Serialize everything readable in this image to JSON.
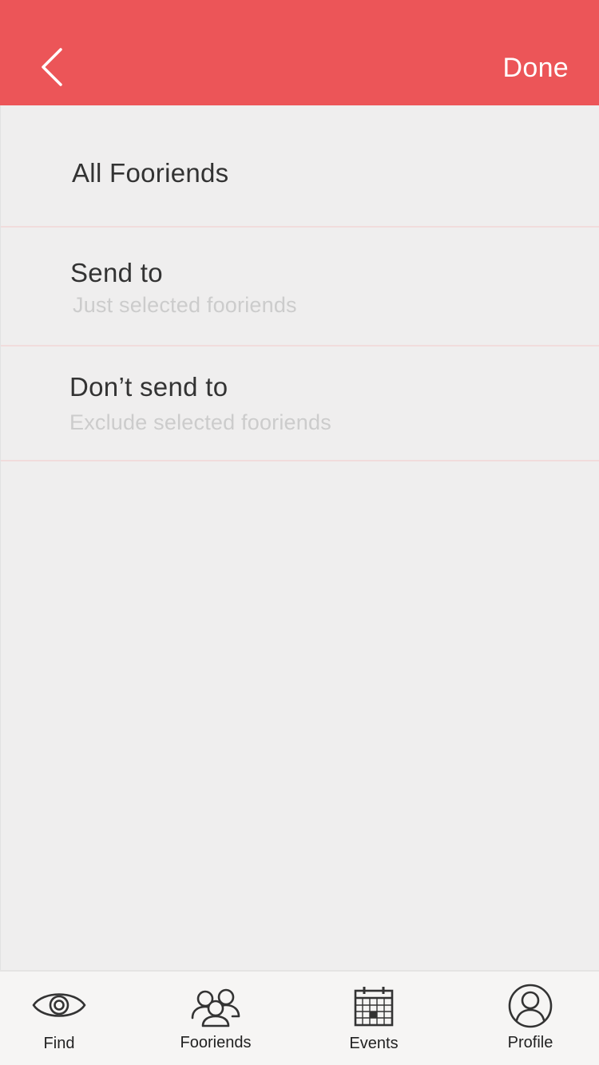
{
  "header": {
    "back_icon": "chevron-left-icon",
    "done_label": "Done",
    "background_color": "#ec5558"
  },
  "options": [
    {
      "title": "All Fooriends",
      "subtitle": ""
    },
    {
      "title": "Send to",
      "subtitle": "Just selected fooriends"
    },
    {
      "title": "Don’t send to",
      "subtitle": "Exclude selected fooriends"
    }
  ],
  "tabbar": {
    "tabs": [
      {
        "label": "Find",
        "icon": "eye-icon"
      },
      {
        "label": "Fooriends",
        "icon": "group-icon"
      },
      {
        "label": "Events",
        "icon": "calendar-icon"
      },
      {
        "label": "Profile",
        "icon": "user-icon"
      }
    ]
  }
}
